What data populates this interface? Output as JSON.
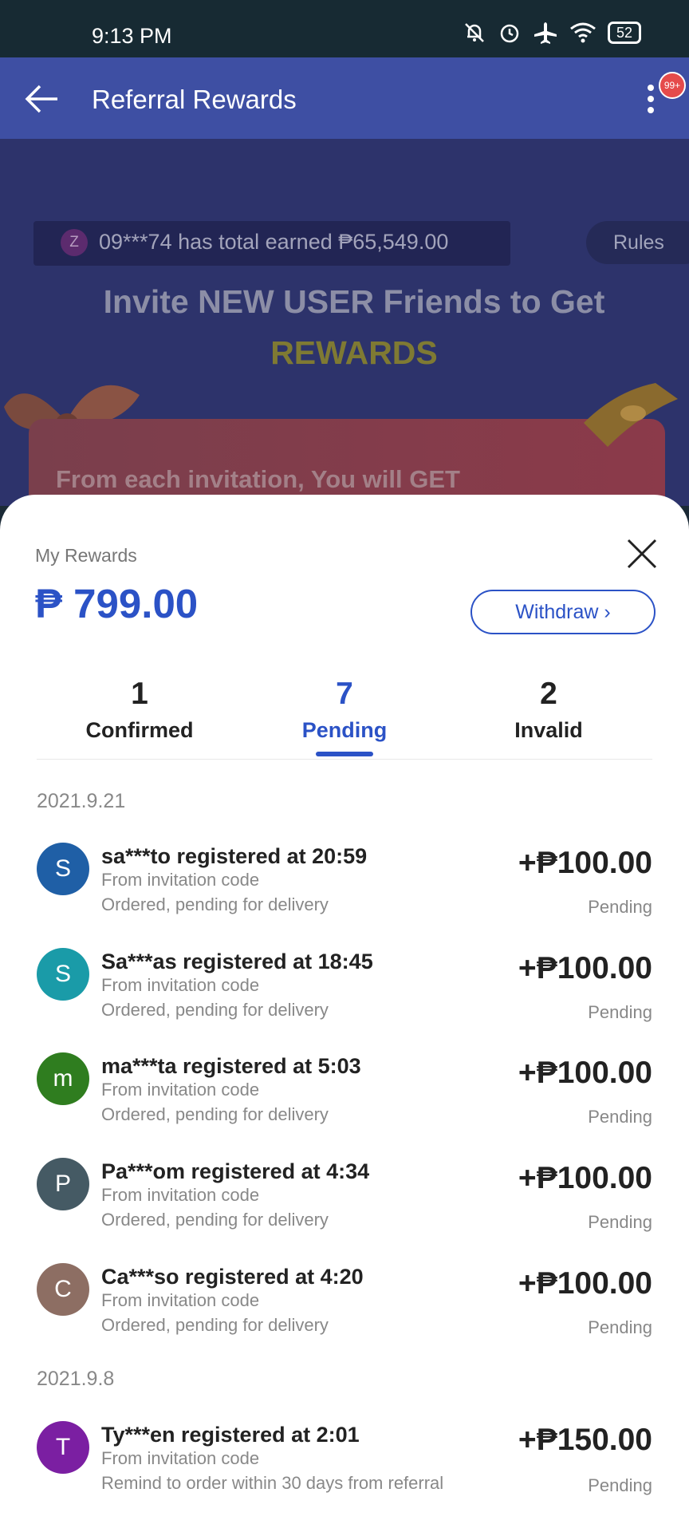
{
  "status_bar": {
    "time": "9:13 PM",
    "battery": "52"
  },
  "app_bar": {
    "title": "Referral Rewards",
    "notification_badge": "99+"
  },
  "banner": {
    "ticker_avatar": "Z",
    "ticker_text": "09***74 has total earned ₱65,549.00",
    "rules_label": "Rules",
    "headline_line1": "Invite NEW USER Friends to Get",
    "headline_line2": "REWARDS",
    "card_text": "From each invitation, You will GET"
  },
  "rewards": {
    "label": "My Rewards",
    "amount": "₱ 799.00",
    "withdraw_label": "Withdraw ›"
  },
  "tabs": [
    {
      "count": "1",
      "label": "Confirmed"
    },
    {
      "count": "7",
      "label": "Pending"
    },
    {
      "count": "2",
      "label": "Invalid"
    }
  ],
  "groups": [
    {
      "date": "2021.9.21",
      "items": [
        {
          "avatar": "S",
          "color": "#1f5fa6",
          "title": "sa***to registered at 20:59",
          "source": "From invitation code",
          "note": "Ordered, pending for delivery",
          "amount": "+₱100.00",
          "status": "Pending"
        },
        {
          "avatar": "S",
          "color": "#1a9ba8",
          "title": "Sa***as registered at 18:45",
          "source": "From invitation code",
          "note": "Ordered, pending for delivery",
          "amount": "+₱100.00",
          "status": "Pending"
        },
        {
          "avatar": "m",
          "color": "#2f7d1f",
          "title": "ma***ta registered at 5:03",
          "source": "From invitation code",
          "note": "Ordered, pending for delivery",
          "amount": "+₱100.00",
          "status": "Pending"
        },
        {
          "avatar": "P",
          "color": "#455a64",
          "title": "Pa***om registered at 4:34",
          "source": "From invitation code",
          "note": "Ordered, pending for delivery",
          "amount": "+₱100.00",
          "status": "Pending"
        },
        {
          "avatar": "C",
          "color": "#8d6e63",
          "title": "Ca***so registered at 4:20",
          "source": "From invitation code",
          "note": "Ordered, pending for delivery",
          "amount": "+₱100.00",
          "status": "Pending"
        }
      ]
    },
    {
      "date": "2021.9.8",
      "items": [
        {
          "avatar": "T",
          "color": "#7b1fa2",
          "title": "Ty***en registered at 2:01",
          "source": "From invitation code",
          "note": "Remind to order within 30 days from referral",
          "amount": "+₱150.00",
          "status": "Pending"
        }
      ]
    }
  ]
}
